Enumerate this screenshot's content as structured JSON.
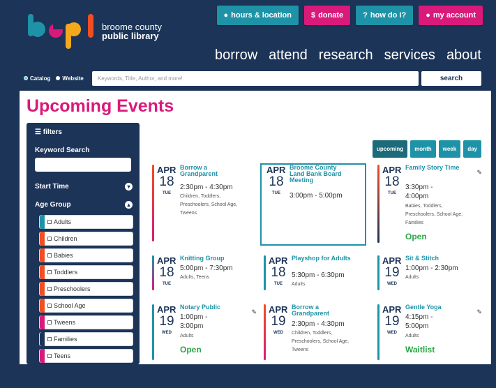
{
  "header": {
    "lib_line1": "broome county",
    "lib_line2": "public library",
    "buttons": [
      {
        "icon": "location-pin-icon",
        "label": "hours & location",
        "color": "#1e93a8"
      },
      {
        "icon": "dollar-icon",
        "label": "donate",
        "color": "#d91a7a"
      },
      {
        "icon": "question-icon",
        "label": "how do i?",
        "color": "#1e93a8"
      },
      {
        "icon": "user-icon",
        "label": "my account",
        "color": "#d91a7a"
      }
    ],
    "nav": [
      "borrow",
      "attend",
      "research",
      "services",
      "about"
    ],
    "search": {
      "radio_catalog": "Catalog",
      "radio_website": "Website",
      "placeholder": "Keywords, Title, Author, and more!",
      "button": "search"
    }
  },
  "page": {
    "title": "Upcoming Events"
  },
  "filters": {
    "title": "filters",
    "keyword_label": "Keyword Search",
    "start_time": "Start Time",
    "age_group": "Age Group",
    "ages": [
      {
        "label": "Adults",
        "color": "#1e93a8"
      },
      {
        "label": "Children",
        "color": "#f04e23"
      },
      {
        "label": "Babies",
        "color": "#f04e23"
      },
      {
        "label": "Toddlers",
        "color": "#f04e23"
      },
      {
        "label": "Preschoolers",
        "color": "#f04e23"
      },
      {
        "label": "School Age",
        "color": "#f04e23"
      },
      {
        "label": "Tweens",
        "color": "#d91a7a"
      },
      {
        "label": "Families",
        "color": "#1c3457"
      },
      {
        "label": "Teens",
        "color": "#d91a7a"
      }
    ]
  },
  "views": [
    "upcoming",
    "month",
    "week",
    "day"
  ],
  "events": [
    {
      "mon": "APR",
      "day": "18",
      "wd": "TUE",
      "title": "Borrow a Grandparent",
      "time": "2:30pm - 4:30pm",
      "ages": "Children, Toddlers, Preschoolers, School Age, Tweens",
      "status": ""
    },
    {
      "mon": "APR",
      "day": "18",
      "wd": "TUE",
      "title": "Broome County Land Bank Board Meeting",
      "time": "3:00pm - 5:00pm",
      "ages": "",
      "status": ""
    },
    {
      "mon": "APR",
      "day": "18",
      "wd": "TUE",
      "title": "Family Story Time",
      "time": "3:30pm - 4:00pm",
      "ages": "Babies, Toddlers, Preschoolers, School Age, Families",
      "status": "Open"
    },
    {
      "mon": "APR",
      "day": "18",
      "wd": "TUE",
      "title": "Knitting Group",
      "time": "5:00pm - 7:30pm",
      "ages": "Adults, Teens",
      "status": ""
    },
    {
      "mon": "APR",
      "day": "18",
      "wd": "TUE",
      "title": "Playshop for Adults",
      "time": "5:30pm - 6:30pm",
      "ages": "Adults",
      "status": ""
    },
    {
      "mon": "APR",
      "day": "19",
      "wd": "WED",
      "title": "Sit & Stitch",
      "time": "1:00pm - 2:30pm",
      "ages": "Adults",
      "status": ""
    },
    {
      "mon": "APR",
      "day": "19",
      "wd": "WED",
      "title": "Notary Public",
      "time": "1:00pm - 3:00pm",
      "ages": "Adults",
      "status": "Open"
    },
    {
      "mon": "APR",
      "day": "19",
      "wd": "WED",
      "title": "Borrow a Grandparent",
      "time": "2:30pm - 4:30pm",
      "ages": "Children, Toddlers, Preschoolers, School Age, Tweens",
      "status": ""
    },
    {
      "mon": "APR",
      "day": "19",
      "wd": "WED",
      "title": "Gentle Yoga",
      "time": "4:15pm - 5:00pm",
      "ages": "Adults",
      "status": "Waitlist"
    }
  ]
}
